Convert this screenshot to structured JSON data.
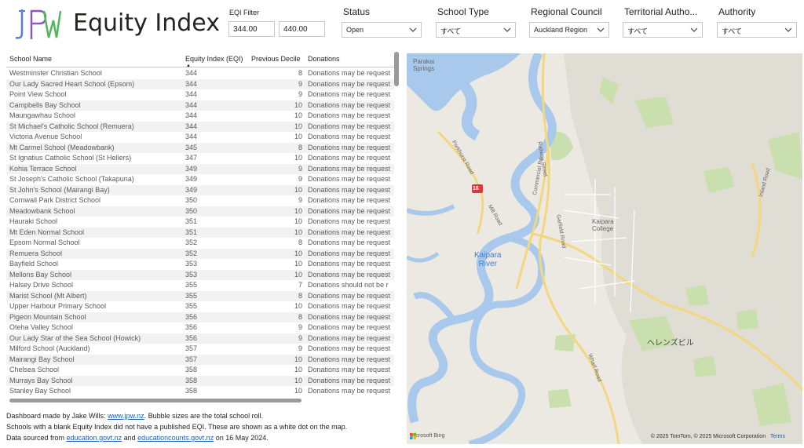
{
  "header": {
    "title": "Equity Index"
  },
  "filters": {
    "eqi": {
      "label": "EQI Filter",
      "min": "344.00",
      "max": "440.00"
    },
    "status": {
      "label": "Status",
      "value": "Open"
    },
    "school_type": {
      "label": "School Type",
      "value": "すべて"
    },
    "regional_council": {
      "label": "Regional Council",
      "value": "Auckland Region"
    },
    "territorial_authority": {
      "label": "Territorial Autho...",
      "value": "すべて"
    },
    "authority": {
      "label": "Authority",
      "value": "すべて"
    }
  },
  "table": {
    "columns": [
      "School Name",
      "Equity Index (EQI)",
      "Previous Decile",
      "Donations"
    ],
    "rows": [
      [
        "Westminster Christian School",
        "344",
        "8",
        "Donations may be request"
      ],
      [
        "Our Lady Sacred Heart School (Epsom)",
        "344",
        "9",
        "Donations may be request"
      ],
      [
        "Point View School",
        "344",
        "9",
        "Donations may be request"
      ],
      [
        "Campbells Bay School",
        "344",
        "10",
        "Donations may be request"
      ],
      [
        "Maungawhau School",
        "344",
        "10",
        "Donations may be request"
      ],
      [
        "St Michael's Catholic School (Remuera)",
        "344",
        "10",
        "Donations may be request"
      ],
      [
        "Victoria Avenue School",
        "344",
        "10",
        "Donations may be request"
      ],
      [
        "Mt Carmel School (Meadowbank)",
        "345",
        "8",
        "Donations may be request"
      ],
      [
        "St Ignatius Catholic School (St Heliers)",
        "347",
        "10",
        "Donations may be request"
      ],
      [
        "Kohia Terrace School",
        "349",
        "9",
        "Donations may be request"
      ],
      [
        "St Joseph's Catholic School (Takapuna)",
        "349",
        "9",
        "Donations may be request"
      ],
      [
        "St John's School (Mairangi Bay)",
        "349",
        "10",
        "Donations may be request"
      ],
      [
        "Cornwall Park District School",
        "350",
        "9",
        "Donations may be request"
      ],
      [
        "Meadowbank School",
        "350",
        "10",
        "Donations may be request"
      ],
      [
        "Hauraki School",
        "351",
        "10",
        "Donations may be request"
      ],
      [
        "Mt Eden Normal School",
        "351",
        "10",
        "Donations may be request"
      ],
      [
        "Epsom Normal School",
        "352",
        "8",
        "Donations may be request"
      ],
      [
        "Remuera School",
        "352",
        "10",
        "Donations may be request"
      ],
      [
        "Bayfield School",
        "353",
        "10",
        "Donations may be request"
      ],
      [
        "Mellons Bay School",
        "353",
        "10",
        "Donations may be request"
      ],
      [
        "Halsey Drive School",
        "355",
        "7",
        "Donations should not be r"
      ],
      [
        "Marist School (Mt Albert)",
        "355",
        "8",
        "Donations may be request"
      ],
      [
        "Upper Harbour Primary School",
        "355",
        "10",
        "Donations may be request"
      ],
      [
        "Pigeon Mountain School",
        "356",
        "8",
        "Donations may be request"
      ],
      [
        "Oteha Valley School",
        "356",
        "9",
        "Donations may be request"
      ],
      [
        "Our Lady Star of the Sea School (Howick)",
        "356",
        "9",
        "Donations may be request"
      ],
      [
        "Milford School (Auckland)",
        "357",
        "9",
        "Donations may be request"
      ],
      [
        "Mairangi Bay School",
        "357",
        "10",
        "Donations may be request"
      ],
      [
        "Chelsea School",
        "358",
        "10",
        "Donations may be request"
      ],
      [
        "Murrays Bay School",
        "358",
        "10",
        "Donations may be request"
      ],
      [
        "Stanley Bay School",
        "358",
        "10",
        "Donations may be request"
      ]
    ]
  },
  "footer": {
    "line1_prefix": "Dashboard made by Jake Wills: ",
    "line1_link": "www.jpw.nz",
    "line1_suffix": ". Bubble sizes are the total school roll.",
    "line2": "Schools with a blank Equity Index did not have a published EQI. These are shown as a white dot on the map.",
    "line3_prefix": "Data sourced from ",
    "line3_link1": "education.govt.nz",
    "line3_mid": " and ",
    "line3_link2": "educationcounts.govt.nz",
    "line3_suffix": " on 16 May 2024."
  },
  "map": {
    "labels": {
      "parakai": "Parakai\nSprings",
      "river": "Kaipara\nRiver",
      "college": "Kaipara\nCollege",
      "helensville": "ヘレンズビル",
      "highway": "16",
      "road_parkhurst": "Parkhurst Road",
      "road_railway": "Railway Street",
      "road_commercial": "Commercial Rd",
      "road_garfield": "Garfield Road",
      "road_inland": "Inland Road",
      "road_mill": "Mill Road",
      "road_wharf": "Wharf Road"
    },
    "attribution": "Microsoft Bing",
    "copyright": "© 2025 TomTom, © 2025 Microsoft Corporation",
    "terms": "Terms"
  },
  "colors": {
    "water": "#a9c9ec",
    "land": "#ece9e3",
    "park": "#c9dfae",
    "road": "#f2d77f",
    "link": "#1a5fb4"
  }
}
